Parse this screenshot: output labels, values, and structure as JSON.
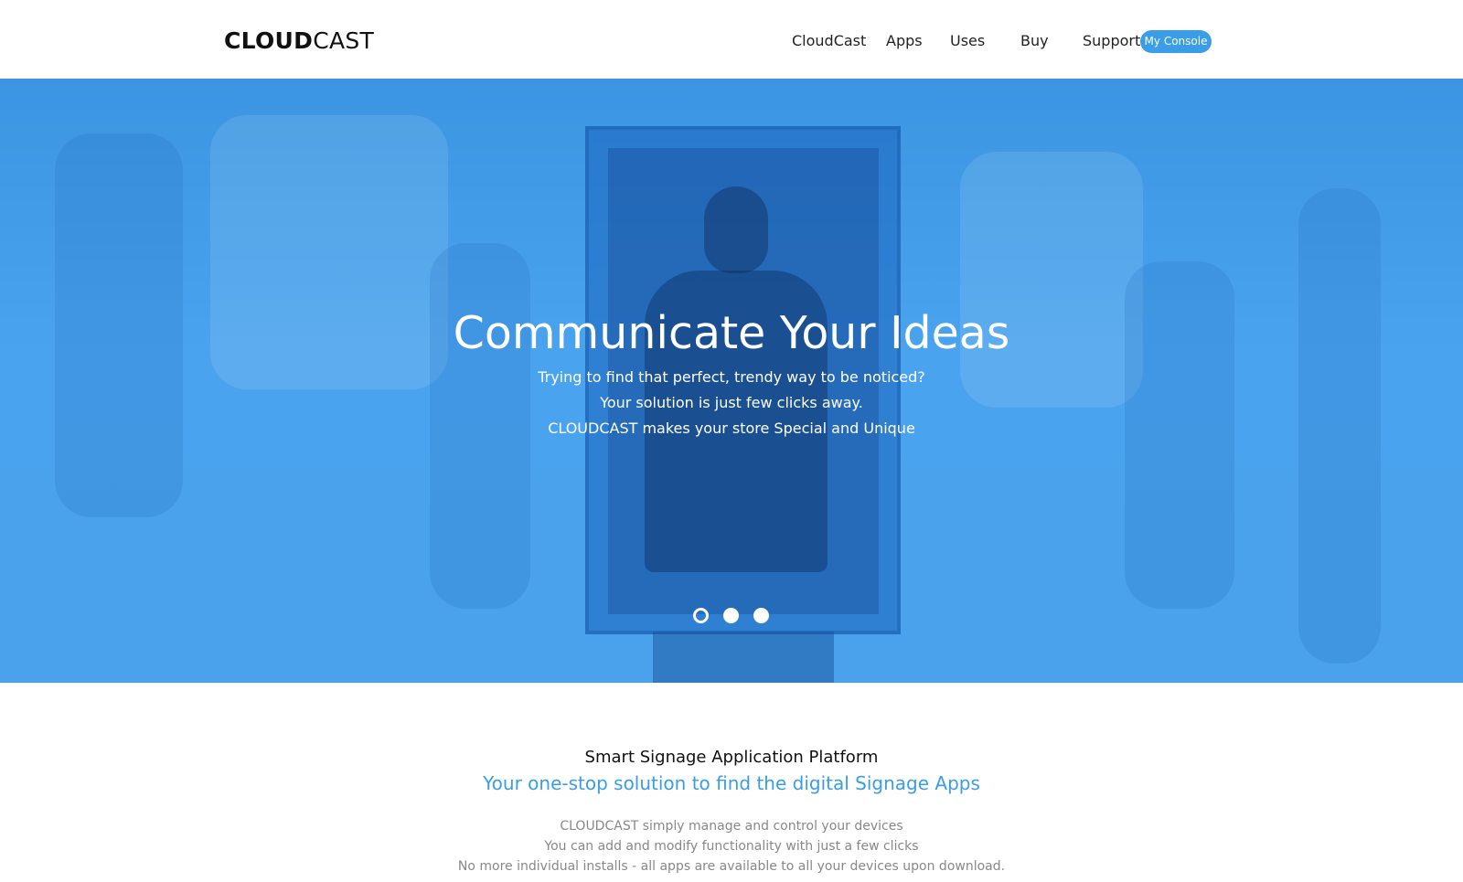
{
  "header": {
    "logo_bold": "CLOUD",
    "logo_light": "CAST",
    "nav": [
      "CloudCast",
      "Apps",
      "Uses",
      "Buy",
      "Support"
    ],
    "console_button": "My Console"
  },
  "hero": {
    "title": "Communicate Your Ideas",
    "lines": [
      "Trying to find that perfect, trendy way to be noticed?",
      "Your solution is just few clicks away.",
      "CLOUDCAST makes your store Special and Unique"
    ],
    "slider": {
      "total": 3,
      "active": 1
    }
  },
  "intro": {
    "title": "Smart Signage Application Platform",
    "subtitle": "Your one-stop solution to find the digital Signage Apps",
    "lines": [
      "CLOUDCAST simply manage and control your devices",
      "You can add and modify functionality with just a few clicks",
      "No more individual installs - all apps are available to all your devices upon download."
    ]
  },
  "colors": {
    "accent": "#3a9de8",
    "hero_blue": "#4aa3ee"
  }
}
